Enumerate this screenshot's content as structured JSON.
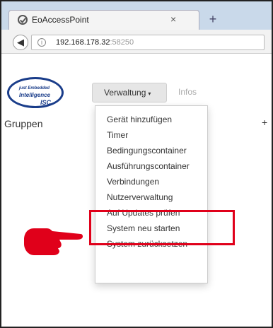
{
  "browser": {
    "tab_title": "EoAccessPoint",
    "tab_close": "×",
    "new_tab": "+",
    "back": "◀",
    "info": "i",
    "url_host": "192.168.178.32",
    "url_port": ":58250"
  },
  "app": {
    "menu": {
      "verwaltung_label": "Verwaltung",
      "caret": "▾",
      "infos_label": "Infos"
    },
    "section_title": "Gruppen",
    "add_symbol": "+",
    "dropdown_items": [
      "Gerät hinzufügen",
      "Timer",
      "Bedingungscontainer",
      "Ausführungscontainer",
      "Verbindungen",
      "Nutzerverwaltung",
      "Auf Updates prüfen",
      "System neu starten",
      "System zurücksetzen"
    ],
    "highlighted_item_index": 6
  },
  "icons": {
    "favicon": "check-circle-icon",
    "back": "back-arrow-icon",
    "info": "info-icon",
    "pointer": "pointing-hand-icon"
  },
  "colors": {
    "highlight": "#e0001a",
    "pointer": "#e0001a",
    "logo": "#1a3d8a",
    "tabstrip": "#c9d9ea"
  }
}
